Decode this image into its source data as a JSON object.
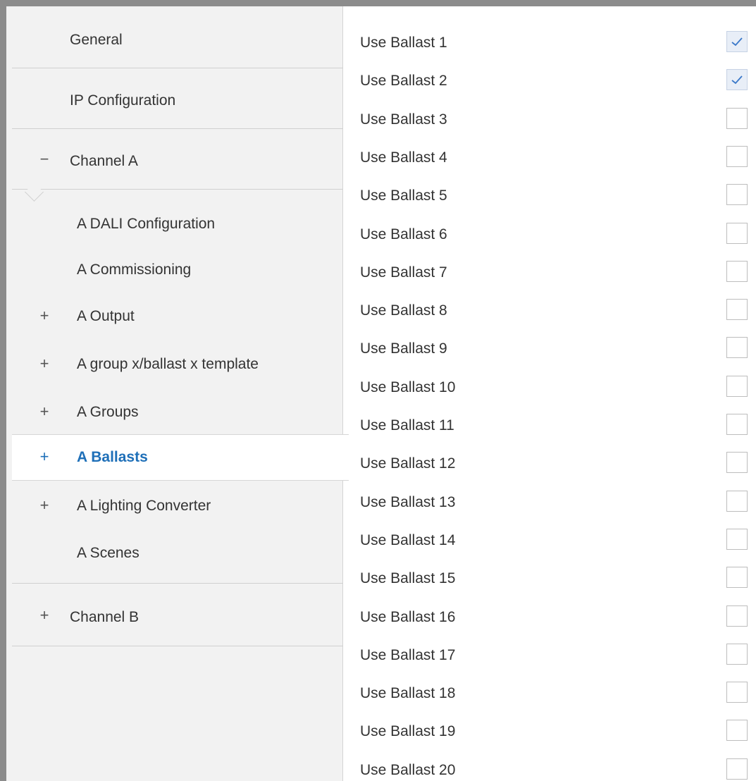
{
  "sidebar": {
    "general": {
      "label": "General"
    },
    "ip_configuration": {
      "label": "IP Configuration"
    },
    "channel_a": {
      "label": "Channel A",
      "sign": "−"
    },
    "channel_a_items": [
      {
        "label": "A DALI Configuration",
        "sign": ""
      },
      {
        "label": "A Commissioning",
        "sign": ""
      },
      {
        "label": "A Output",
        "sign": "+"
      },
      {
        "label": "A group x/ballast x template",
        "sign": "+"
      },
      {
        "label": "A Groups",
        "sign": "+"
      },
      {
        "label": "A Ballasts",
        "sign": "+",
        "selected": true
      },
      {
        "label": "A Lighting Converter",
        "sign": "+"
      },
      {
        "label": "A Scenes",
        "sign": ""
      }
    ],
    "channel_b": {
      "label": "Channel B",
      "sign": "+"
    }
  },
  "main": {
    "rows": [
      {
        "label": "Use Ballast 1",
        "checked": true
      },
      {
        "label": "Use Ballast 2",
        "checked": true
      },
      {
        "label": "Use Ballast 3",
        "checked": false
      },
      {
        "label": "Use Ballast 4",
        "checked": false
      },
      {
        "label": "Use Ballast 5",
        "checked": false
      },
      {
        "label": "Use Ballast 6",
        "checked": false
      },
      {
        "label": "Use Ballast 7",
        "checked": false
      },
      {
        "label": "Use Ballast 8",
        "checked": false
      },
      {
        "label": "Use Ballast 9",
        "checked": false
      },
      {
        "label": "Use Ballast 10",
        "checked": false
      },
      {
        "label": "Use Ballast 11",
        "checked": false
      },
      {
        "label": "Use Ballast 12",
        "checked": false
      },
      {
        "label": "Use Ballast 13",
        "checked": false
      },
      {
        "label": "Use Ballast 14",
        "checked": false
      },
      {
        "label": "Use Ballast 15",
        "checked": false
      },
      {
        "label": "Use Ballast 16",
        "checked": false
      },
      {
        "label": "Use Ballast 17",
        "checked": false
      },
      {
        "label": "Use Ballast 18",
        "checked": false
      },
      {
        "label": "Use Ballast 19",
        "checked": false
      },
      {
        "label": "Use Ballast 20",
        "checked": false
      }
    ]
  },
  "colors": {
    "selected_accent": "#1e6fb8",
    "sidebar_bg": "#f2f2f2",
    "checked_box_bg": "#e8eef7",
    "checkmark": "#3a78c9"
  }
}
